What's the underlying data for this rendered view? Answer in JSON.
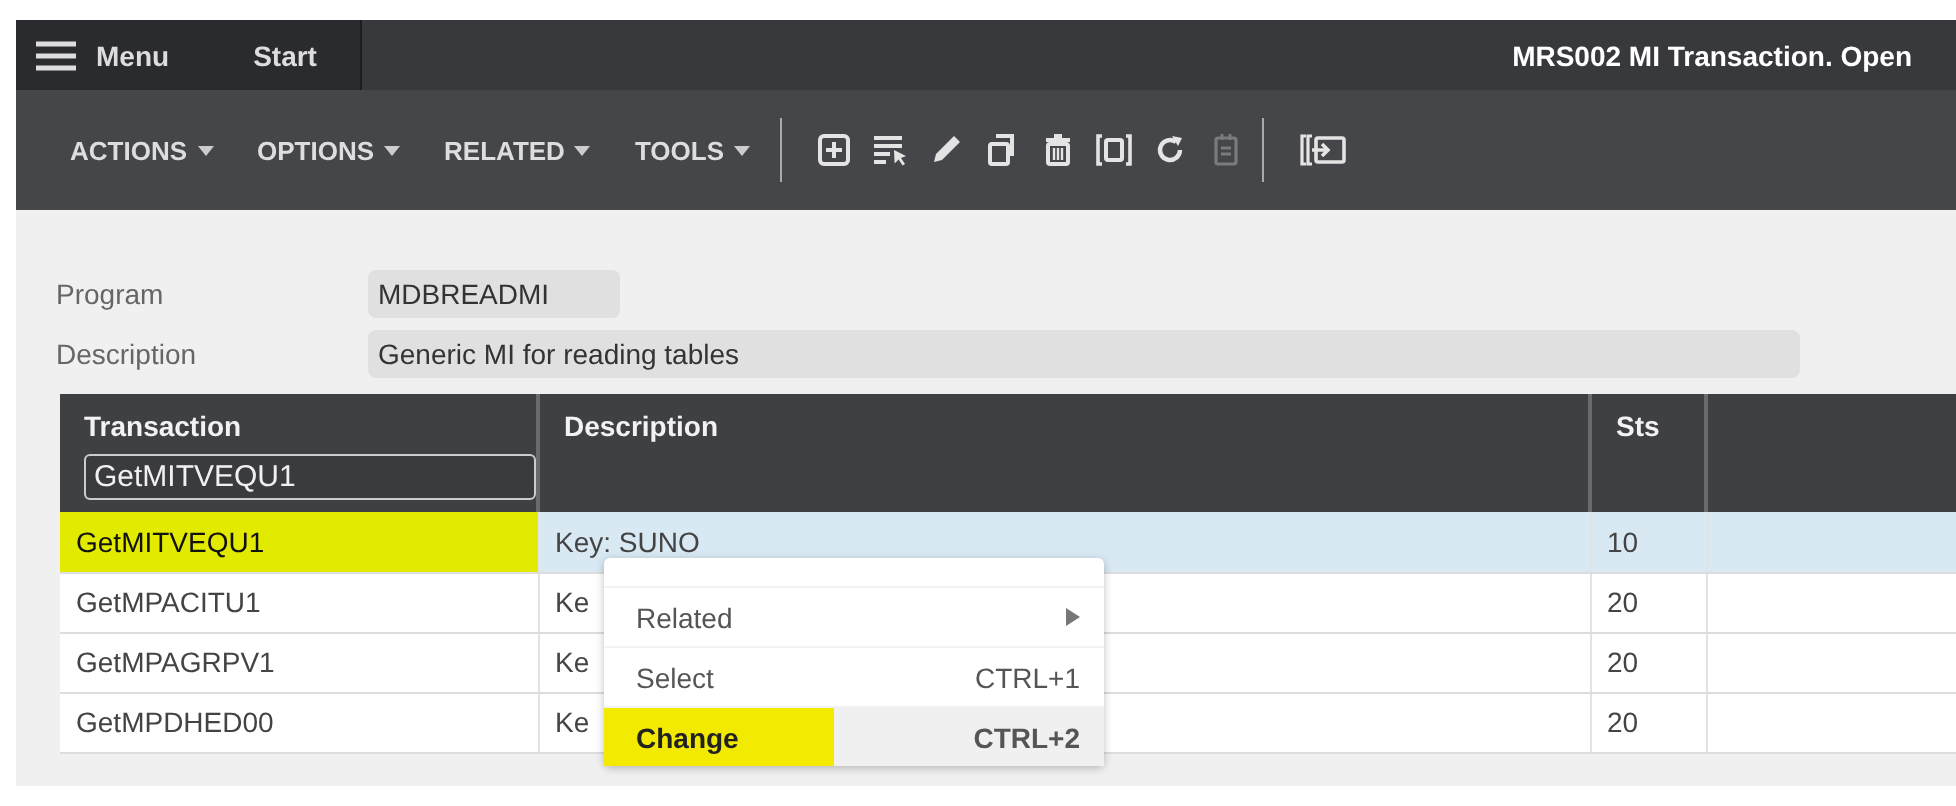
{
  "top_bar": {
    "menu_label": "Menu",
    "tabs": [
      {
        "label": "Start",
        "selected": false
      }
    ],
    "title": "MRS002 MI Transaction. Open"
  },
  "toolbar": {
    "menus": [
      "ACTIONS",
      "OPTIONS",
      "RELATED",
      "TOOLS"
    ],
    "icon_groups": [
      [
        {
          "kind": "add",
          "disabled": false
        },
        {
          "kind": "select-list",
          "disabled": false
        },
        {
          "kind": "edit",
          "disabled": false
        },
        {
          "kind": "copy",
          "disabled": false
        },
        {
          "kind": "delete",
          "disabled": false
        },
        {
          "kind": "display",
          "disabled": false
        },
        {
          "kind": "refresh",
          "disabled": false
        },
        {
          "kind": "notes",
          "disabled": true
        }
      ],
      [
        {
          "kind": "panel",
          "disabled": false
        }
      ]
    ]
  },
  "fields": [
    {
      "label": "Program",
      "value": "MDBREADMI",
      "wide": false
    },
    {
      "label": "Description",
      "value": "Generic MI for reading tables",
      "wide": true
    }
  ],
  "table": {
    "columns": [
      "Transaction",
      "Description",
      "Sts"
    ],
    "filter": "GetMITVEQU1",
    "rows": [
      {
        "transaction": "GetMITVEQU1",
        "description": "Key: SUNO",
        "status": "10",
        "selected": true,
        "highlighted": true
      },
      {
        "transaction": "GetMPACITU1",
        "description": "Ke",
        "status": "20",
        "selected": false,
        "highlighted": false
      },
      {
        "transaction": "GetMPAGRPV1",
        "description": "Ke",
        "status": "20",
        "selected": false,
        "highlighted": false
      },
      {
        "transaction": "GetMPDHED00",
        "description": "Ke",
        "status": "20",
        "selected": false,
        "highlighted": false
      }
    ]
  },
  "context_menu": {
    "items": [
      {
        "label": "Related",
        "submenu": true,
        "hovered": false,
        "highlighted": false
      },
      {
        "label": "Select",
        "shortcut": "CTRL+1",
        "submenu": false,
        "hovered": false,
        "highlighted": false
      },
      {
        "label": "Change",
        "shortcut": "CTRL+2",
        "submenu": false,
        "hovered": true,
        "highlighted": true
      }
    ]
  }
}
